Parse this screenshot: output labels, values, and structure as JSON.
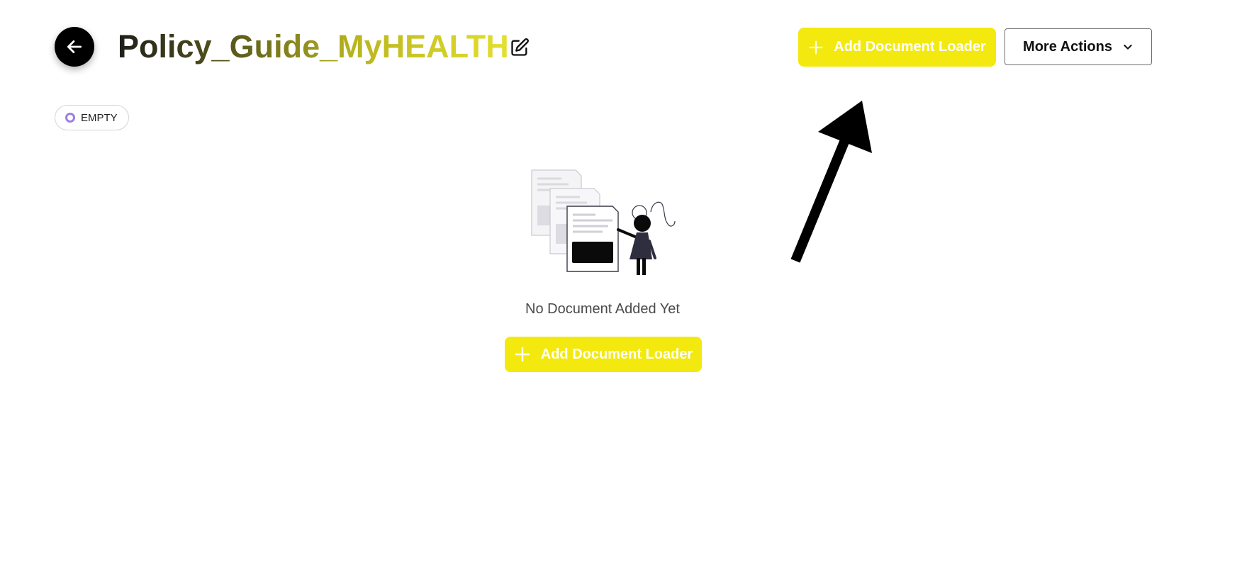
{
  "header": {
    "title": "Policy_Guide_MyHEALTH",
    "back_icon": "arrow-left-icon",
    "edit_icon": "pencil-square-icon",
    "add_loader_label": "Add Document Loader",
    "more_actions_label": "More Actions"
  },
  "status": {
    "label": "EMPTY",
    "color": "#9b7fe0"
  },
  "empty_state": {
    "illustration": "documents-person-illustration",
    "message": "No Document Added Yet",
    "add_loader_label": "Add Document Loader"
  },
  "colors": {
    "accent": "#f3e90f",
    "title_gradient_start": "#1f1f1a",
    "title_gradient_end": "#e4e030",
    "annotation_arrow": "#000000"
  }
}
